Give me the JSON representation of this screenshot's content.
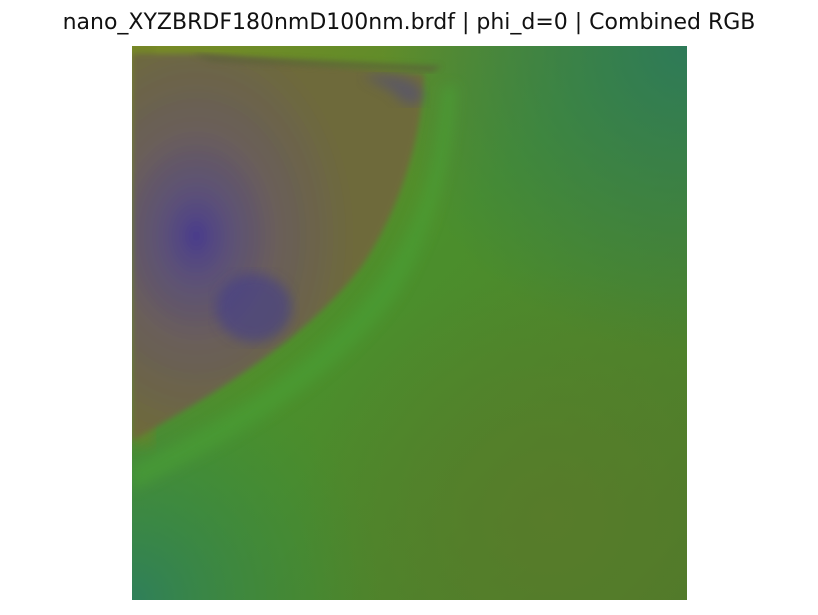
{
  "figure": {
    "title": "nano_XYZBRDF180nmD100nm.brdf | phi_d=0 | Combined RGB"
  },
  "image": {
    "description_colors": {
      "base_green": "#4a8a2a",
      "olive": "#7a8a26",
      "teal": "#2f7a52",
      "gray_brown": "#6b5f58",
      "violet": "#4a3a8a"
    }
  }
}
